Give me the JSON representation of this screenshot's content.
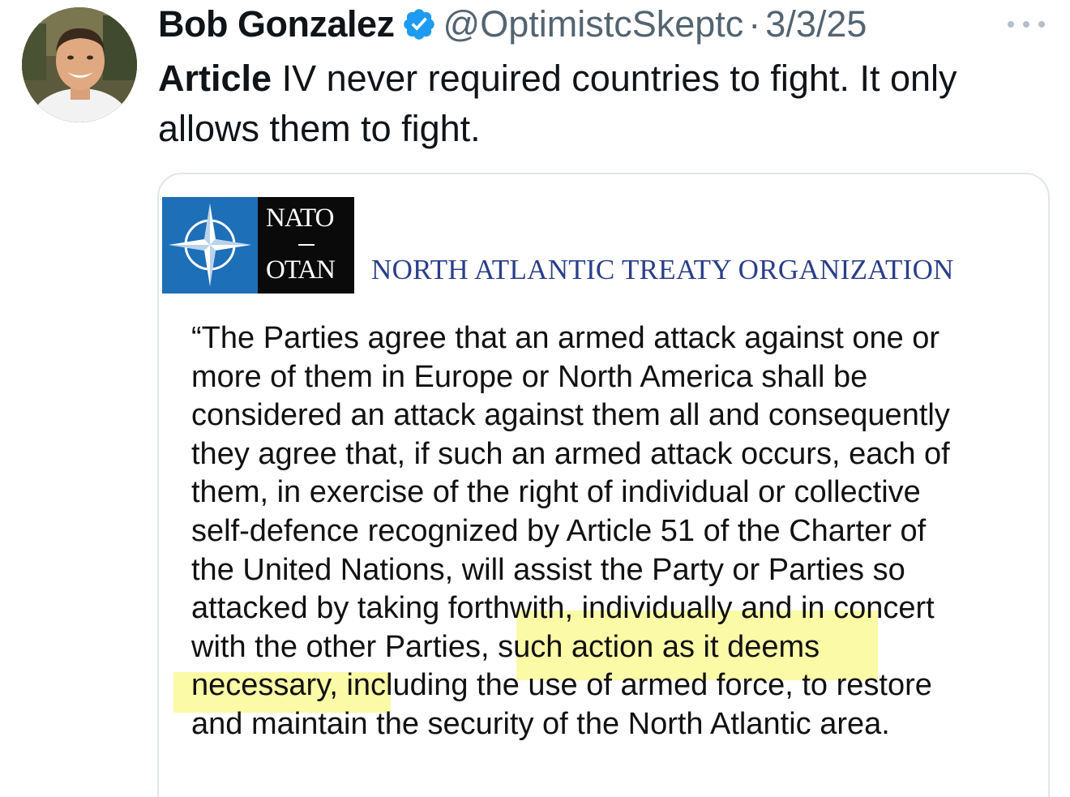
{
  "tweet": {
    "display_name": "Bob Gonzalez",
    "handle": "@OptimistcSkeptc",
    "separator": "·",
    "date": "3/3/25",
    "verified_icon": "verified-badge-icon",
    "more_icon": "more-options-icon",
    "text_bold": "Article",
    "text_rest": " IV never required countries to fight. It only allows them to fight."
  },
  "media": {
    "logo_top": "NATO",
    "logo_bottom": "OTAN",
    "org_name": "NORTH ATLANTIC TREATY ORGANIZATION",
    "article_text": "“The Parties agree that an armed attack against one or\nmore of them in Europe or North America shall be\nconsidered an attack against them all and consequently\nthey agree that, if such an armed attack occurs, each of\nthem, in exercise of the right of individual or collective\nself-defence recognized by Article 51 of the Charter of\nthe United Nations, will assist the Party or Parties so\nattacked by taking forthwith, individually and in concert\nwith the other Parties, such action as it deems\nnecessary, including the use of armed force, to restore\nand maintain the security of the North Atlantic area.",
    "highlight_color": "#f5f55f",
    "logo_blue": "#1d6fb8",
    "org_name_color": "#2a3e8a"
  }
}
